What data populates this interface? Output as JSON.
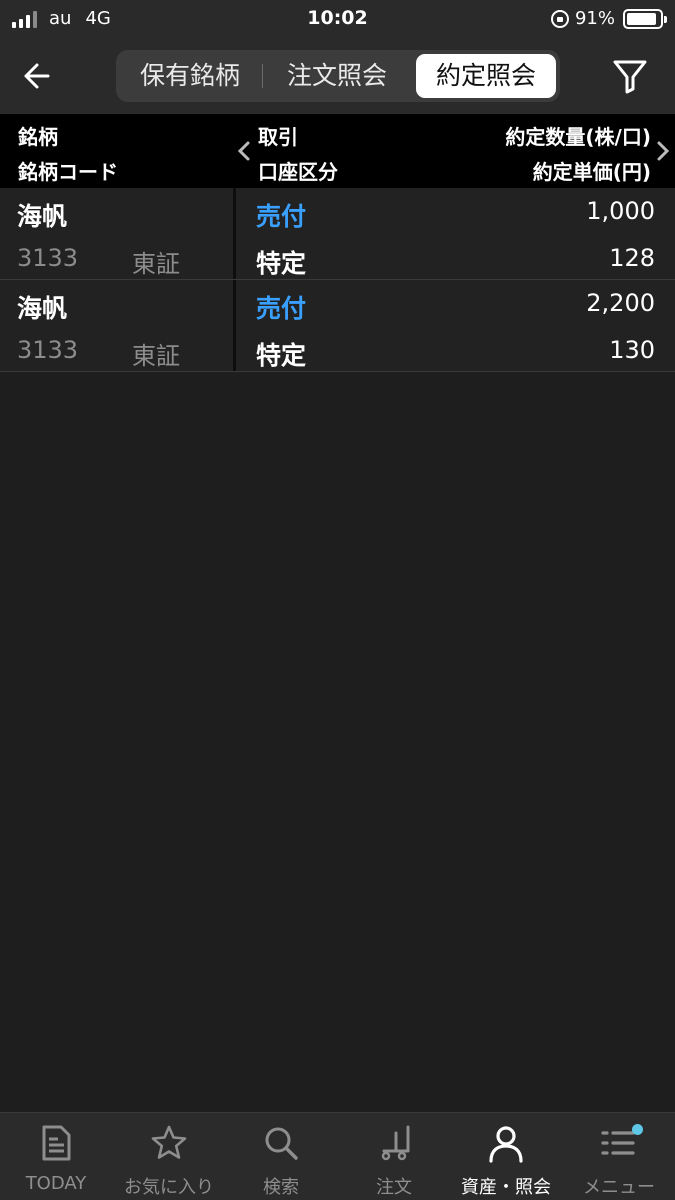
{
  "status_bar": {
    "carrier": "au",
    "network": "4G",
    "time": "10:02",
    "battery": "91%"
  },
  "header": {
    "tabs": [
      {
        "label": "保有銘柄",
        "selected": false
      },
      {
        "label": "注文照会",
        "selected": false
      },
      {
        "label": "約定照会",
        "selected": true
      }
    ]
  },
  "columns": {
    "name": "銘柄",
    "code": "銘柄コード",
    "trade": "取引",
    "account": "口座区分",
    "quantity": "約定数量(株/口)",
    "price": "約定単価(円)"
  },
  "rows": [
    {
      "name": "海帆",
      "code": "3133",
      "market": "東証",
      "trade": "売付",
      "account": "特定",
      "quantity": "1,000",
      "price": "128"
    },
    {
      "name": "海帆",
      "code": "3133",
      "market": "東証",
      "trade": "売付",
      "account": "特定",
      "quantity": "2,200",
      "price": "130"
    }
  ],
  "tabbar": {
    "items": [
      {
        "label": "TODAY",
        "icon": "news-icon"
      },
      {
        "label": "お気に入り",
        "icon": "star-icon"
      },
      {
        "label": "検索",
        "icon": "search-icon"
      },
      {
        "label": "注文",
        "icon": "cart-icon"
      },
      {
        "label": "資産・照会",
        "icon": "person-icon",
        "active": true
      },
      {
        "label": "メニュー",
        "icon": "menu-icon"
      }
    ]
  },
  "colors": {
    "accent_blue": "#3aa0ff",
    "background": "#1e1e1e",
    "notification_dot": "#5ec8e6"
  }
}
